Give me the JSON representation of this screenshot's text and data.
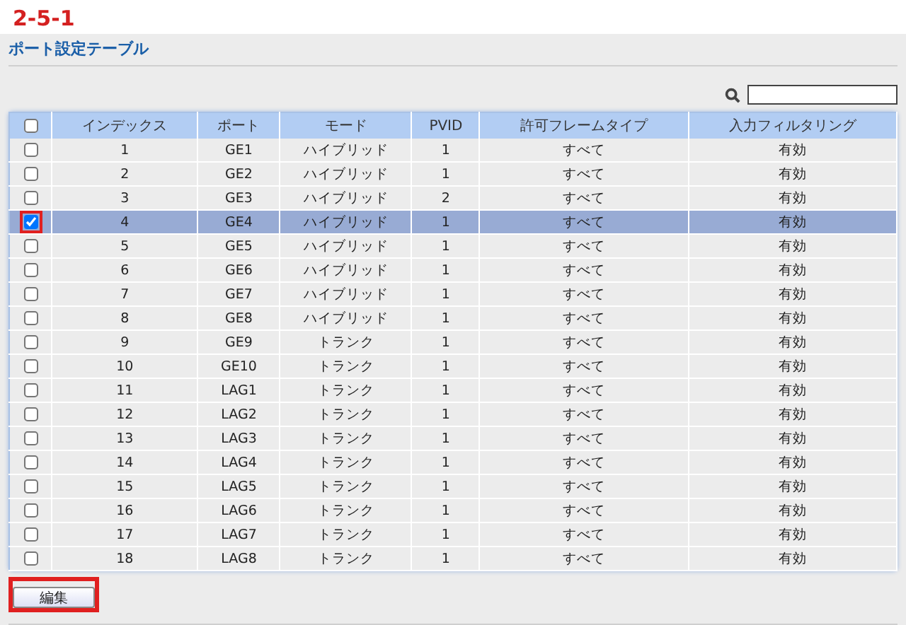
{
  "section_number": "2-5-1",
  "panel_title": "ポート設定テーブル",
  "search": {
    "kind": "text"
  },
  "table": {
    "select_all": {
      "checked": false
    },
    "columns": [
      "インデックス",
      "ポート",
      "モード",
      "PVID",
      "許可フレームタイプ",
      "入力フィルタリング"
    ],
    "rows": [
      {
        "cells": [
          "1",
          "GE1",
          "ハイブリッド",
          "1",
          "すべて",
          "有効"
        ],
        "selected": false,
        "highlighted": false
      },
      {
        "cells": [
          "2",
          "GE2",
          "ハイブリッド",
          "1",
          "すべて",
          "有効"
        ],
        "selected": false,
        "highlighted": false
      },
      {
        "cells": [
          "3",
          "GE3",
          "ハイブリッド",
          "2",
          "すべて",
          "有効"
        ],
        "selected": false,
        "highlighted": false
      },
      {
        "cells": [
          "4",
          "GE4",
          "ハイブリッド",
          "1",
          "すべて",
          "有効"
        ],
        "selected": true,
        "highlighted": true
      },
      {
        "cells": [
          "5",
          "GE5",
          "ハイブリッド",
          "1",
          "すべて",
          "有効"
        ],
        "selected": false,
        "highlighted": false
      },
      {
        "cells": [
          "6",
          "GE6",
          "ハイブリッド",
          "1",
          "すべて",
          "有効"
        ],
        "selected": false,
        "highlighted": false
      },
      {
        "cells": [
          "7",
          "GE7",
          "ハイブリッド",
          "1",
          "すべて",
          "有効"
        ],
        "selected": false,
        "highlighted": false
      },
      {
        "cells": [
          "8",
          "GE8",
          "ハイブリッド",
          "1",
          "すべて",
          "有効"
        ],
        "selected": false,
        "highlighted": false
      },
      {
        "cells": [
          "9",
          "GE9",
          "トランク",
          "1",
          "すべて",
          "有効"
        ],
        "selected": false,
        "highlighted": false
      },
      {
        "cells": [
          "10",
          "GE10",
          "トランク",
          "1",
          "すべて",
          "有効"
        ],
        "selected": false,
        "highlighted": false
      },
      {
        "cells": [
          "11",
          "LAG1",
          "トランク",
          "1",
          "すべて",
          "有効"
        ],
        "selected": false,
        "highlighted": false
      },
      {
        "cells": [
          "12",
          "LAG2",
          "トランク",
          "1",
          "すべて",
          "有効"
        ],
        "selected": false,
        "highlighted": false
      },
      {
        "cells": [
          "13",
          "LAG3",
          "トランク",
          "1",
          "すべて",
          "有効"
        ],
        "selected": false,
        "highlighted": false
      },
      {
        "cells": [
          "14",
          "LAG4",
          "トランク",
          "1",
          "すべて",
          "有効"
        ],
        "selected": false,
        "highlighted": false
      },
      {
        "cells": [
          "15",
          "LAG5",
          "トランク",
          "1",
          "すべて",
          "有効"
        ],
        "selected": false,
        "highlighted": false
      },
      {
        "cells": [
          "16",
          "LAG6",
          "トランク",
          "1",
          "すべて",
          "有効"
        ],
        "selected": false,
        "highlighted": false
      },
      {
        "cells": [
          "17",
          "LAG7",
          "トランク",
          "1",
          "すべて",
          "有効"
        ],
        "selected": false,
        "highlighted": false
      },
      {
        "cells": [
          "18",
          "LAG8",
          "トランク",
          "1",
          "すべて",
          "有効"
        ],
        "selected": false,
        "highlighted": false
      }
    ]
  },
  "edit_button": {
    "label": "編集",
    "highlighted": true
  }
}
